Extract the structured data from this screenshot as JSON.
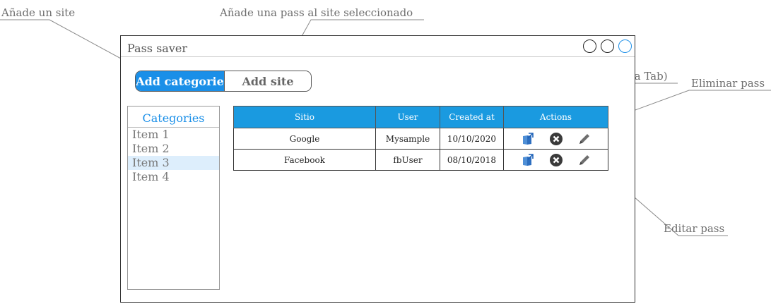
{
  "annotations": {
    "add_site": "Añade un site",
    "add_pass": "Añade una pass al site seleccionado",
    "open_url": "Abrir URL(en otra Tab)",
    "delete_pass": "Eliminar pass",
    "edit_pass": "Editar pass"
  },
  "window": {
    "title": "Pass saver"
  },
  "toolbar": {
    "add_category_label": "Add categorie",
    "add_site_label": "Add site"
  },
  "categories": {
    "header": "Categories",
    "items": [
      {
        "label": "Item 1"
      },
      {
        "label": "Item 2"
      },
      {
        "label": "Item 3"
      },
      {
        "label": "Item 4"
      }
    ]
  },
  "table": {
    "columns": [
      "Sitio",
      "User",
      "Created at",
      "Actions"
    ],
    "rows": [
      {
        "site": "Google",
        "user": "Mysample",
        "created": "10/10/2020"
      },
      {
        "site": "Facebook",
        "user": "fbUser",
        "created": "08/10/2018"
      }
    ]
  },
  "colors": {
    "accent": "#1a8fe8",
    "header": "#1a9ae0"
  }
}
